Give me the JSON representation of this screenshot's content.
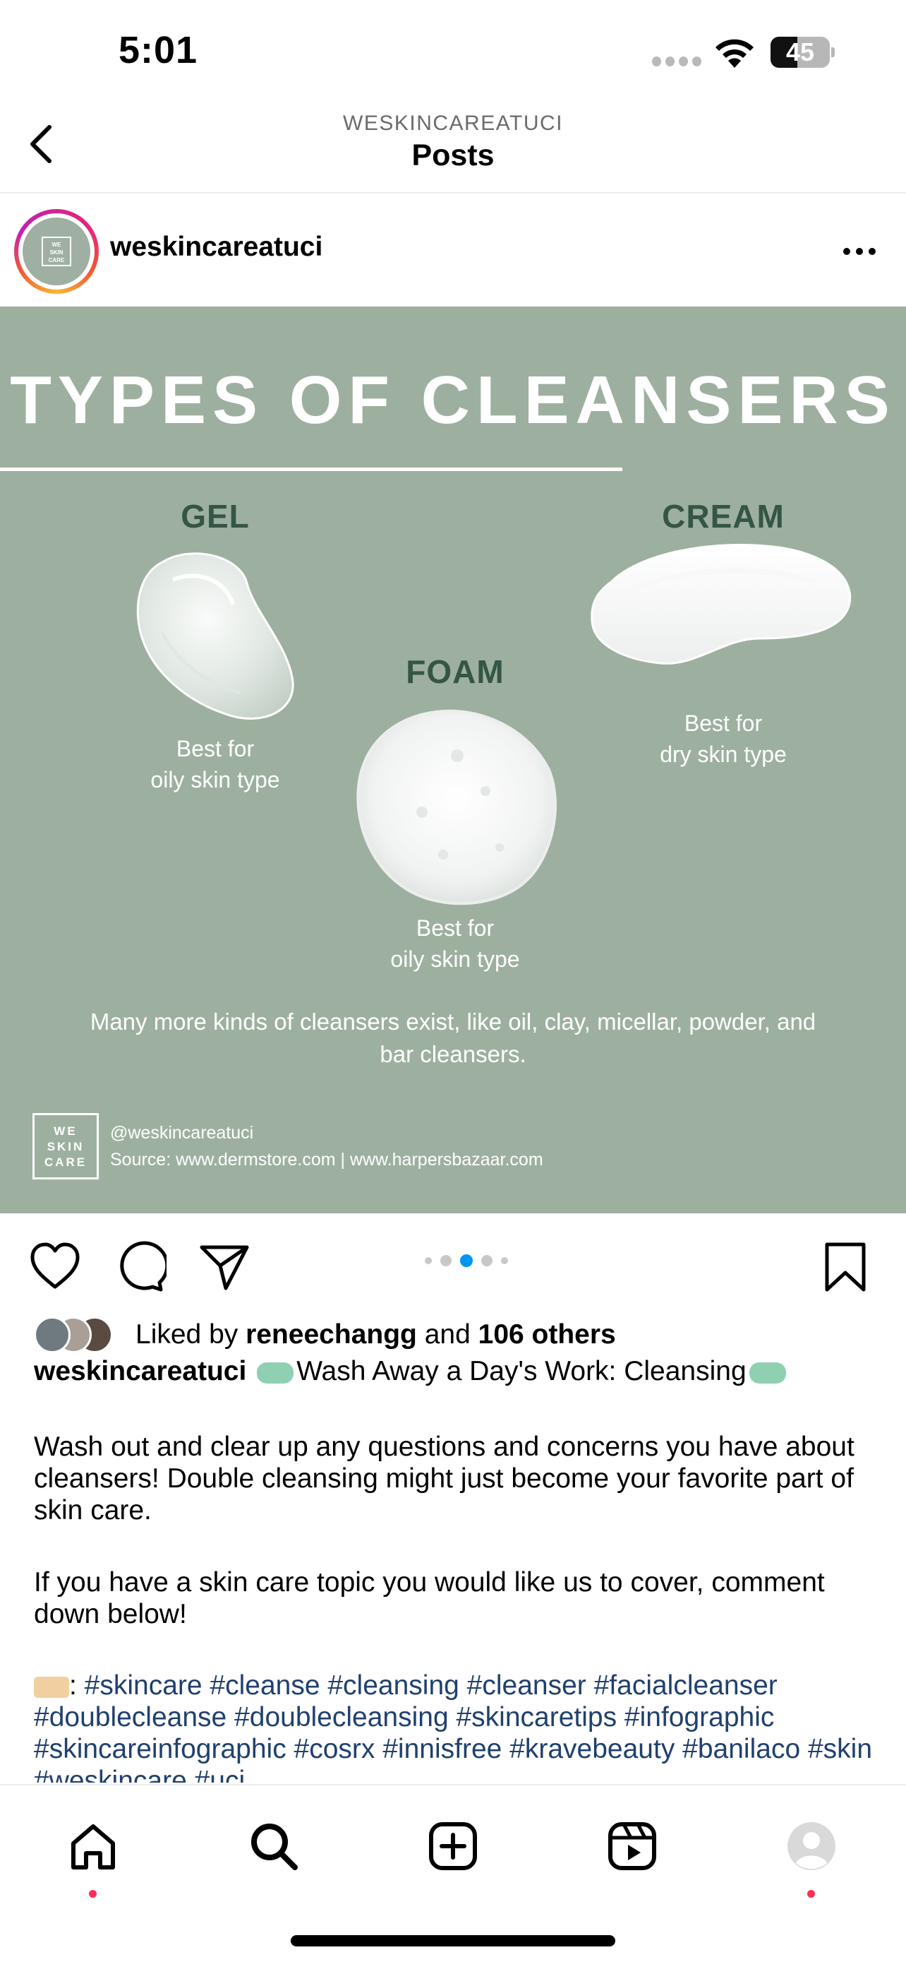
{
  "status_bar": {
    "time": "5:01",
    "battery": "45",
    "battery_level": 0.45
  },
  "header": {
    "account": "WESKINCAREATUCI",
    "title": "Posts",
    "back_icon": "chevron-left-icon"
  },
  "post": {
    "username": "weskincareatuci",
    "avatar_logo": [
      "WE",
      "SKIN",
      "CARE"
    ],
    "more_icon": "ellipsis-icon",
    "image": {
      "title": "TYPES OF CLEANSERS",
      "gel": {
        "label": "GEL",
        "caption_1": "Best for",
        "caption_2": "oily skin type"
      },
      "foam": {
        "label": "FOAM",
        "caption_1": "Best for",
        "caption_2": "oily skin type"
      },
      "cream": {
        "label": "CREAM",
        "caption_1": "Best for",
        "caption_2": "dry skin type"
      },
      "note_1": "Many more kinds of cleansers exist, like oil, clay, micellar, powder, and",
      "note_2": "bar cleansers.",
      "brand": [
        "WE",
        "SKIN",
        "CARE"
      ],
      "handle": "@weskincareatuci",
      "source": "Source: www.dermstore.com | www.harpersbazaar.com"
    },
    "carousel": {
      "count": 5,
      "active_index": 2
    },
    "actions": {
      "like_icon": "heart-icon",
      "comment_icon": "comment-icon",
      "share_icon": "paper-plane-icon",
      "save_icon": "bookmark-icon"
    },
    "likes": {
      "prefix": "Liked by",
      "user": "reneechangg",
      "middle": "and",
      "others": "106 others"
    },
    "caption": {
      "username": "weskincareatuci",
      "headline": "Wash Away a Day's Work: Cleansing",
      "para_1": "Wash out and clear up any questions and concerns you have about cleansers! Double cleansing might just become your favorite part of skin care.",
      "para_2": "If you have a skin care topic you would like us to cover, comment down below!",
      "hashtags": "#skincare #cleanse #cleansing #cleanser #facialcleanser #doublecleanse #doublecleansing #skincaretips #infographic #skincareinfographic #cosrx #innisfree #kravebeauty #banilaco #skin #weskincare #uci"
    }
  },
  "tab_bar": {
    "items": [
      {
        "name": "home",
        "icon": "home-icon",
        "badge": true
      },
      {
        "name": "search",
        "icon": "search-icon",
        "badge": false
      },
      {
        "name": "create",
        "icon": "plus-square-icon",
        "badge": false
      },
      {
        "name": "reels",
        "icon": "reels-icon",
        "badge": false
      },
      {
        "name": "profile",
        "icon": "profile-avatar-icon",
        "badge": true
      }
    ]
  },
  "colors": {
    "accent_blue": "#0095f6",
    "hashtag": "#20406e",
    "infographic_bg": "#9db09f",
    "label_green": "#355545",
    "badge_red": "#ff2d55"
  }
}
